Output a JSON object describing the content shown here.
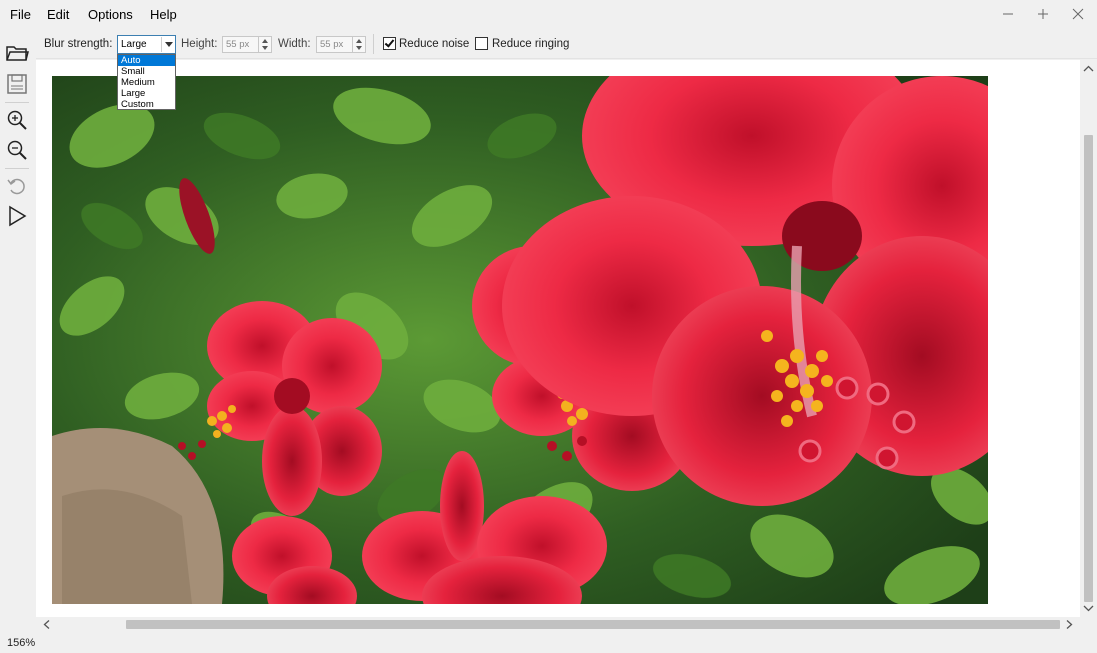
{
  "menu": {
    "file": "File",
    "edit": "Edit",
    "options": "Options",
    "help": "Help"
  },
  "window_controls": {
    "minimize": "—",
    "maximize": "+",
    "close": "✕"
  },
  "toolbar": {
    "blur_strength_label": "Blur strength:",
    "blur_strength_value": "Large",
    "blur_strength_options": [
      "Auto",
      "Small",
      "Medium",
      "Large",
      "Custom"
    ],
    "blur_strength_highlighted": "Auto",
    "height_label": "Height:",
    "height_value": "55 px",
    "width_label": "Width:",
    "width_value": "55 px",
    "reduce_noise_label": "Reduce noise",
    "reduce_noise_checked": true,
    "reduce_ringing_label": "Reduce ringing",
    "reduce_ringing_checked": false
  },
  "sidebar": {
    "tools": [
      "open-folder-icon",
      "save-icon",
      "zoom-in-icon",
      "zoom-out-icon",
      "undo-icon",
      "run-icon"
    ]
  },
  "status": {
    "zoom": "156%"
  },
  "colors": {
    "selection_blue": "#0078d7",
    "panel_bg": "#f0f0f0",
    "flower_red": "#e8243a",
    "leaf_green": "#4a8a2c"
  }
}
